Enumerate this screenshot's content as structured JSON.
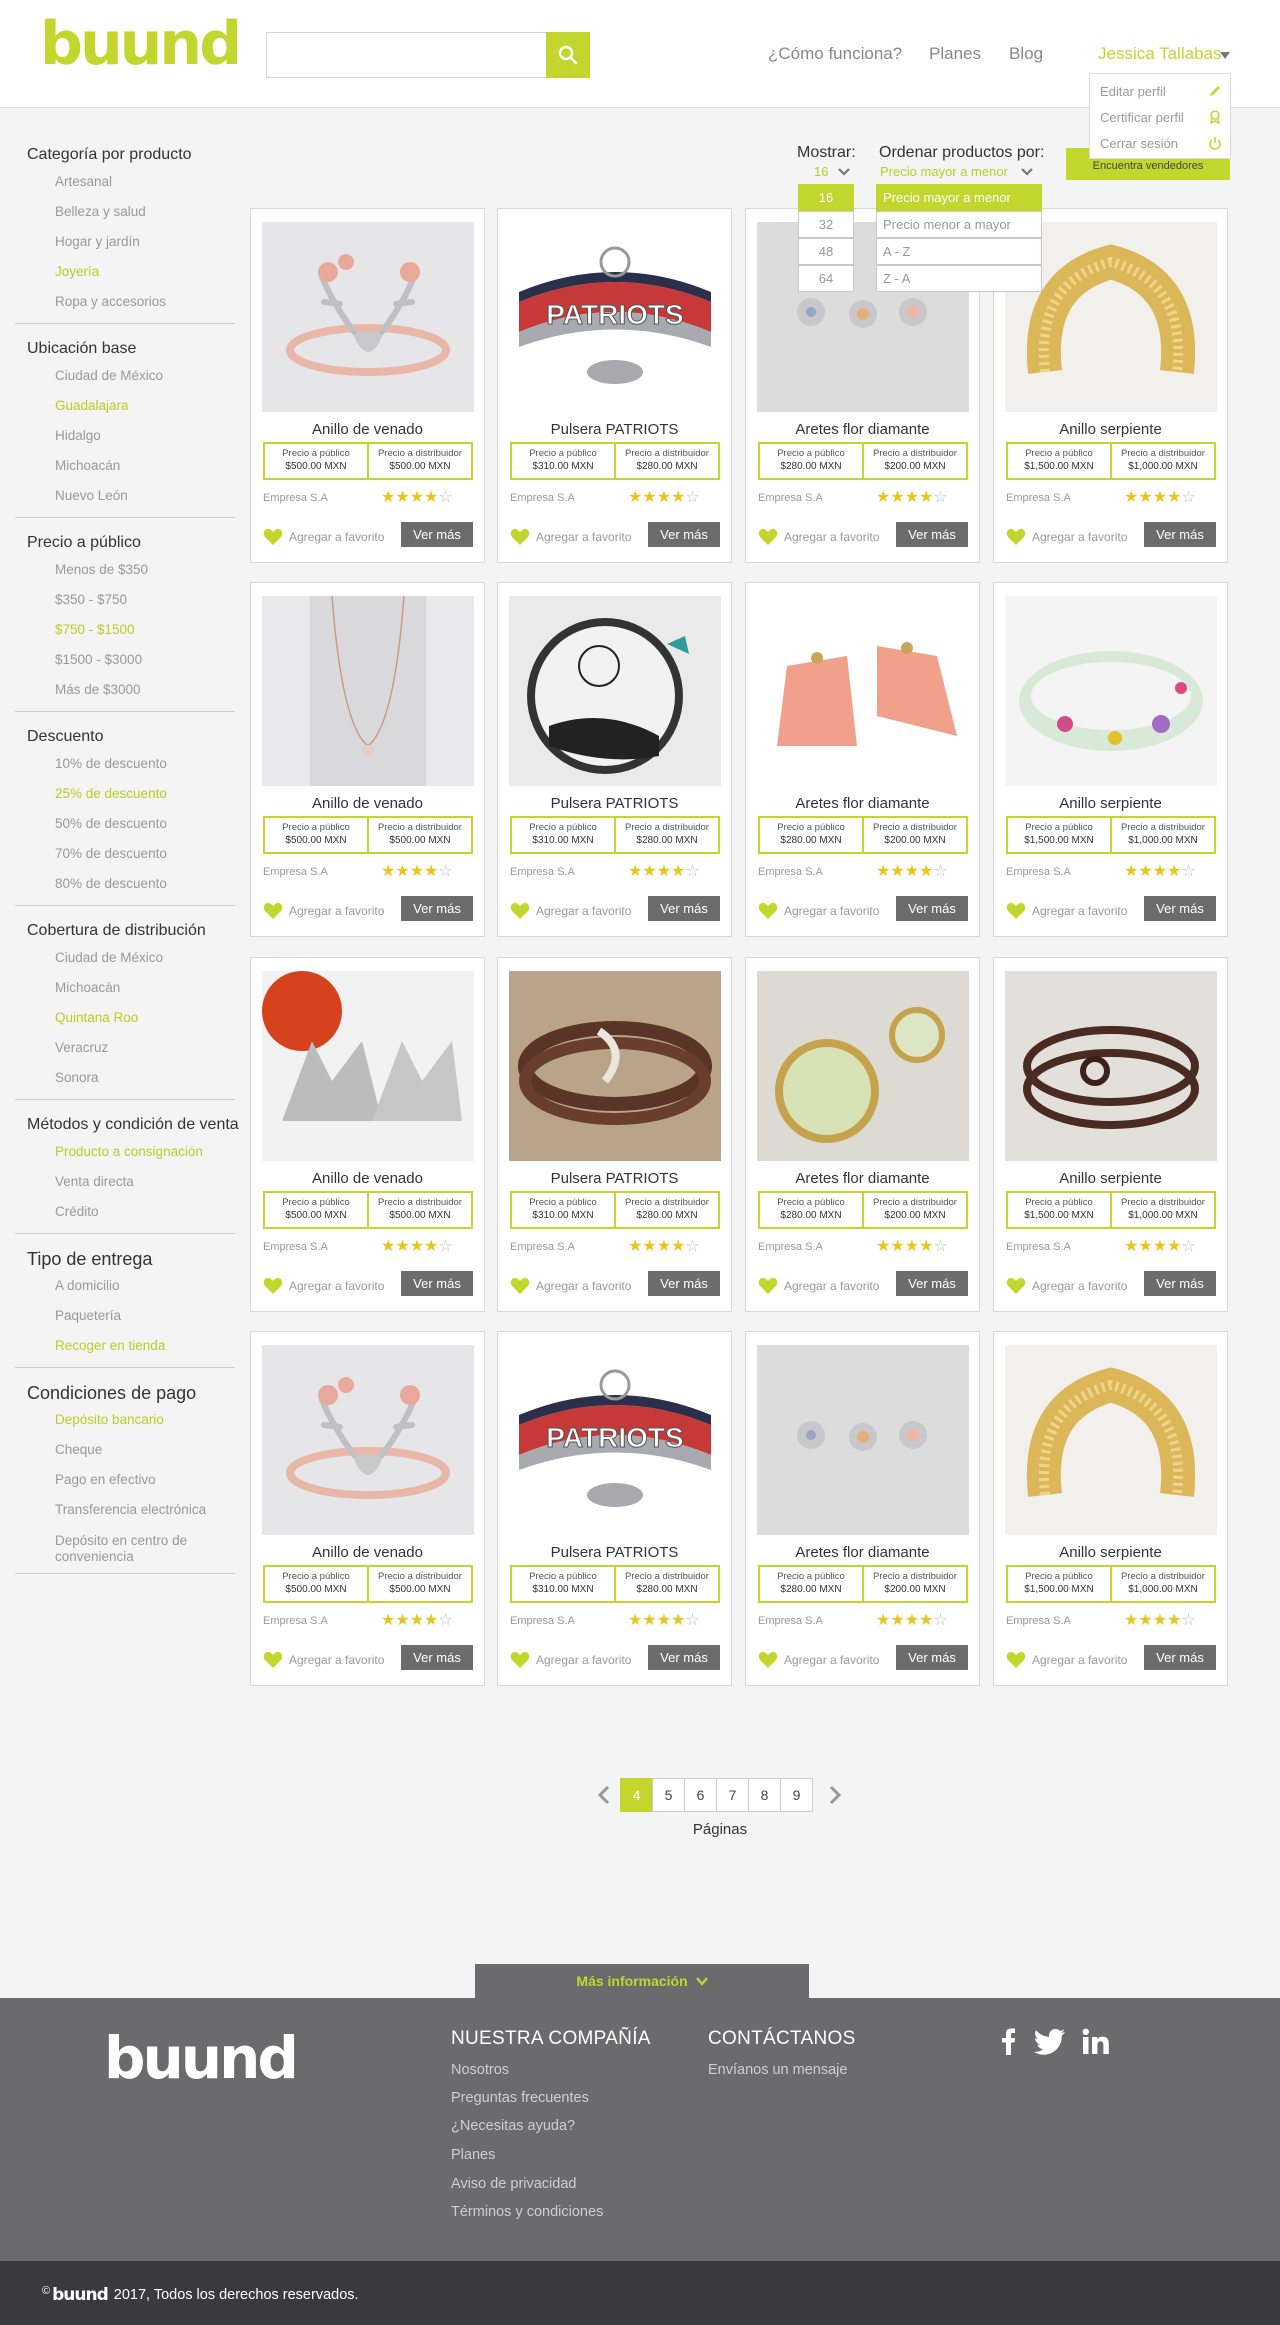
{
  "brand": {
    "logo_text": "buund",
    "accent_color": "#c2d62e"
  },
  "search": {
    "placeholder": ""
  },
  "nav": {
    "how_it_works": "¿Cómo funciona?",
    "plans": "Planes",
    "blog": "Blog",
    "user_name": "Jessica Tallabas"
  },
  "user_menu": [
    "Editar perfil",
    "Certificar perfil",
    "Cerrar sesión"
  ],
  "sidebar": {
    "groups": [
      {
        "title": "Categoría por producto",
        "items": [
          {
            "label": "Artesanal"
          },
          {
            "label": "Belleza y salud"
          },
          {
            "label": "Hogar y jardín"
          },
          {
            "label": "Joyería",
            "active": true
          },
          {
            "label": "Ropa y accesorios"
          }
        ]
      },
      {
        "title": "Ubicación base",
        "items": [
          {
            "label": "Ciudad de México"
          },
          {
            "label": "Guadalajara",
            "active": true
          },
          {
            "label": "Hidalgo"
          },
          {
            "label": "Michoacán"
          },
          {
            "label": "Nuevo León"
          }
        ]
      },
      {
        "title": "Precio a público",
        "items": [
          {
            "label": "Menos de $350"
          },
          {
            "label": "$350 - $750"
          },
          {
            "label": "$750 - $1500",
            "active": true
          },
          {
            "label": "$1500 - $3000"
          },
          {
            "label": "Más de $3000"
          }
        ]
      },
      {
        "title": "Descuento",
        "items": [
          {
            "label": "10% de descuento"
          },
          {
            "label": "25% de descuento",
            "active": true
          },
          {
            "label": "50% de descuento"
          },
          {
            "label": "70% de descuento"
          },
          {
            "label": "80% de descuento"
          }
        ]
      },
      {
        "title": "Cobertura de distribución",
        "items": [
          {
            "label": "Ciudad de México"
          },
          {
            "label": "Michoacán"
          },
          {
            "label": "Quintana Roo",
            "active": true
          },
          {
            "label": "Veracruz"
          },
          {
            "label": "Sonora"
          }
        ]
      },
      {
        "title": "Métodos y condición de venta",
        "items": [
          {
            "label": "Producto a consignación",
            "active": true
          },
          {
            "label": "Venta directa"
          },
          {
            "label": "Crédito"
          }
        ]
      },
      {
        "title": "Tipo de entrega",
        "big": true,
        "items": [
          {
            "label": "A domicilio"
          },
          {
            "label": "Paquetería"
          },
          {
            "label": "Recoger en tienda",
            "active": true
          }
        ]
      },
      {
        "title": "Condiciones de pago",
        "big": true,
        "items": [
          {
            "label": "Depósito bancario",
            "active": true
          },
          {
            "label": "Cheque"
          },
          {
            "label": "Pago en efectivo"
          },
          {
            "label": "Transferencia electrónica"
          },
          {
            "label": "Depósito en centro de conveniencia",
            "two_line": true
          }
        ]
      }
    ]
  },
  "toolbar": {
    "show_label": "Mostrar:",
    "show_value": "16",
    "show_options": [
      "16",
      "32",
      "48",
      "64"
    ],
    "sort_label": "Ordenar productos por:",
    "sort_value": "Precio mayor a menor",
    "sort_options": [
      "Precio mayor a menor",
      "Precio menor a mayor",
      "A - Z",
      "Z - A"
    ],
    "find_vendors": "Encuentra vendedores"
  },
  "product_labels": {
    "public_price": "Precio a público",
    "distributor_price": "Precio a distribuidor",
    "favorite": "Agregar a favorito",
    "see_more": "Ver más"
  },
  "products": [
    {
      "title": "Anillo de venado",
      "public": "$500.00 MXN",
      "dist": "$500.00 MXN",
      "company": "Empresa S.A",
      "rating": 4,
      "img": "antler-ring"
    },
    {
      "title": "Pulsera PATRIOTS",
      "public": "$310.00 MXN",
      "dist": "$280.00 MXN",
      "company": "Empresa S.A",
      "rating": 4,
      "img": "patriots-bracelet"
    },
    {
      "title": "Aretes flor diamante",
      "public": "$280.00 MXN",
      "dist": "$200.00 MXN",
      "company": "Empresa S.A",
      "rating": 4,
      "img": "flower-earrings"
    },
    {
      "title": "Anillo serpiente",
      "public": "$1,500.00 MXN",
      "dist": "$1,000.00 MXN",
      "company": "Empresa S.A",
      "rating": 4,
      "img": "gold-cuff"
    },
    {
      "title": "Anillo de venado",
      "public": "$500.00 MXN",
      "dist": "$500.00 MXN",
      "company": "Empresa S.A",
      "rating": 4,
      "img": "necklace"
    },
    {
      "title": "Pulsera PATRIOTS",
      "public": "$310.00 MXN",
      "dist": "$280.00 MXN",
      "company": "Empresa S.A",
      "rating": 4,
      "img": "locket"
    },
    {
      "title": "Aretes flor diamante",
      "public": "$280.00 MXN",
      "dist": "$200.00 MXN",
      "company": "Empresa S.A",
      "rating": 4,
      "img": "tassel-earrings"
    },
    {
      "title": "Anillo serpiente",
      "public": "$1,500.00 MXN",
      "dist": "$1,000.00 MXN",
      "company": "Empresa S.A",
      "rating": 4,
      "img": "resin-bangle"
    },
    {
      "title": "Anillo de venado",
      "public": "$500.00 MXN",
      "dist": "$500.00 MXN",
      "company": "Empresa S.A",
      "rating": 4,
      "img": "fox-earrings"
    },
    {
      "title": "Pulsera PATRIOTS",
      "public": "$310.00 MXN",
      "dist": "$280.00 MXN",
      "company": "Empresa S.A",
      "rating": 4,
      "img": "leather-wrap"
    },
    {
      "title": "Aretes flor diamante",
      "public": "$280.00 MXN",
      "dist": "$200.00 MXN",
      "company": "Empresa S.A",
      "rating": 4,
      "img": "map-cufflinks"
    },
    {
      "title": "Anillo serpiente",
      "public": "$1,500.00 MXN",
      "dist": "$1,000.00 MXN",
      "company": "Empresa S.A",
      "rating": 4,
      "img": "knot-bracelet"
    },
    {
      "title": "Anillo de venado",
      "public": "$500.00 MXN",
      "dist": "$500.00 MXN",
      "company": "Empresa S.A",
      "rating": 4,
      "img": "antler-ring"
    },
    {
      "title": "Pulsera PATRIOTS",
      "public": "$310.00 MXN",
      "dist": "$280.00 MXN",
      "company": "Empresa S.A",
      "rating": 4,
      "img": "patriots-bracelet"
    },
    {
      "title": "Aretes flor diamante",
      "public": "$280.00 MXN",
      "dist": "$200.00 MXN",
      "company": "Empresa S.A",
      "rating": 4,
      "img": "flower-earrings"
    },
    {
      "title": "Anillo serpiente",
      "public": "$1,500.00 MXN",
      "dist": "$1,000.00 MXN",
      "company": "Empresa S.A",
      "rating": 4,
      "img": "gold-cuff"
    }
  ],
  "pagination": {
    "pages": [
      "4",
      "5",
      "6",
      "7",
      "8",
      "9"
    ],
    "active": "4",
    "label": "Páginas"
  },
  "footer": {
    "more_info": "Más información",
    "logo_text": "buund",
    "company_heading": "NUESTRA COMPAÑÍA",
    "company_links": [
      "Nosotros",
      "Preguntas frecuentes",
      "¿Necesitas ayuda?",
      "Planes",
      "Aviso de privacidad",
      "Términos y condiciones"
    ],
    "contact_heading": "CONTÁCTANOS",
    "contact_link": "Envíanos un mensaje",
    "social": [
      "facebook-icon",
      "twitter-icon",
      "linkedin-icon"
    ],
    "copyright_symbol": "©",
    "copyright_brand": "buund",
    "copyright_text": "2017, Todos los derechos reservados."
  }
}
